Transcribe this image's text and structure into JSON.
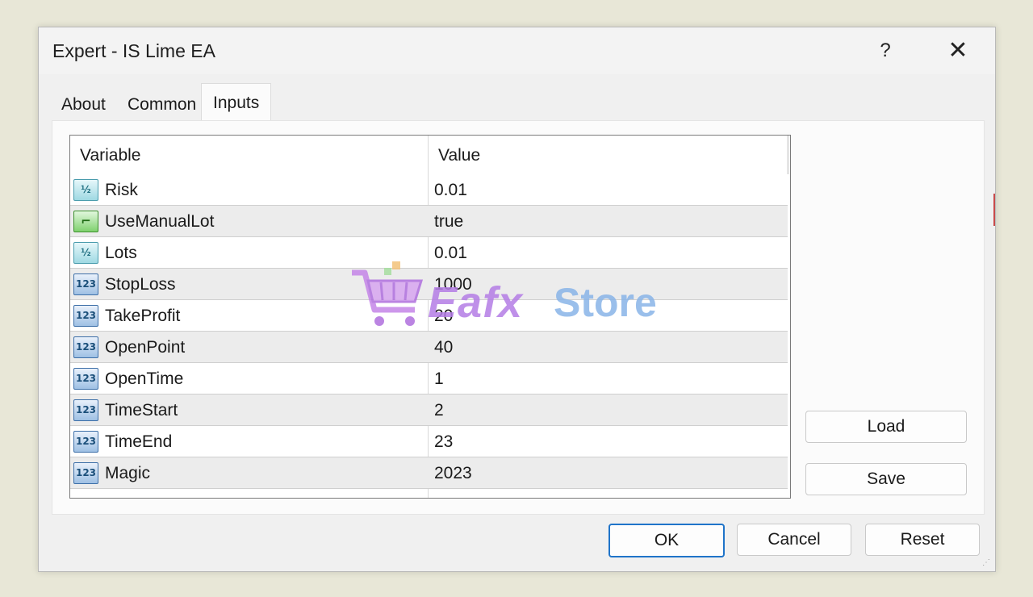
{
  "window": {
    "title": "Expert - IS Lime EA",
    "help_label": "?",
    "close_label": "✕"
  },
  "tabs": [
    {
      "label": "About"
    },
    {
      "label": "Common"
    },
    {
      "label": "Inputs"
    }
  ],
  "active_tab": "Inputs",
  "grid": {
    "columns": [
      "Variable",
      "Value"
    ],
    "rows": [
      {
        "type_icon": "double-icon",
        "variable": "Risk",
        "value": "0.01"
      },
      {
        "type_icon": "bool-icon",
        "variable": "UseManualLot",
        "value": "true"
      },
      {
        "type_icon": "double-icon",
        "variable": "Lots",
        "value": "0.01"
      },
      {
        "type_icon": "integer-icon",
        "variable": "StopLoss",
        "value": "1000"
      },
      {
        "type_icon": "integer-icon",
        "variable": "TakeProfit",
        "value": "20"
      },
      {
        "type_icon": "integer-icon",
        "variable": "OpenPoint",
        "value": "40"
      },
      {
        "type_icon": "integer-icon",
        "variable": "OpenTime",
        "value": "1"
      },
      {
        "type_icon": "integer-icon",
        "variable": "TimeStart",
        "value": "2"
      },
      {
        "type_icon": "integer-icon",
        "variable": "TimeEnd",
        "value": "23"
      },
      {
        "type_icon": "integer-icon",
        "variable": "Magic",
        "value": "2023"
      }
    ]
  },
  "icon_glyphs": {
    "double": "½",
    "integer": "123",
    "bool": "⌐"
  },
  "side_buttons": {
    "load_label": "Load",
    "save_label": "Save"
  },
  "footer_buttons": {
    "ok_label": "OK",
    "cancel_label": "Cancel",
    "reset_label": "Reset"
  },
  "watermark": {
    "part1": "Eafx",
    "part2": "Store"
  },
  "colors": {
    "accent": "#1f74c9",
    "row_alt": "#ececec"
  }
}
